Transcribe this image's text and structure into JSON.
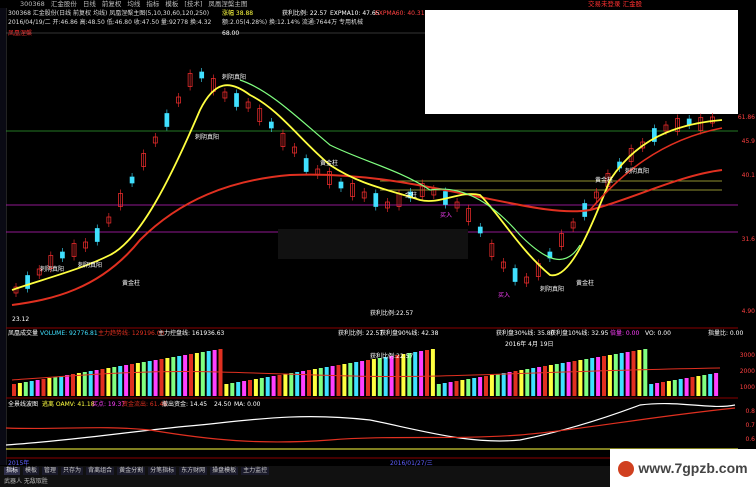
{
  "menu": [
    "300368",
    "汇金股份",
    "日线",
    "前复权",
    "均线",
    "指标",
    "模板",
    "[技术]",
    "凤凰涅槃主图"
  ],
  "right_tab": "交易未登录  汇金股",
  "header": {
    "line1": "300368 汇金股份(日线 前复权 均线) 凤凰涅槃主图(5,10,30,60,120,250)",
    "line1_b": "获利比例: 22.57",
    "line1_c": "EXPMA10: 47.65",
    "line1_d": "EXPMA60: 40.31",
    "line2": "2016/04/19/二 开:46.86 高:48.50 低:46.80 收:47.50 量:92778 换:4.32",
    "line2_b": "额:2.05(4.28%) 换:12.14% 流通:7644万 专用机械",
    "tag": "凤凰涅槃",
    "value_green": "涨幅 38.88"
  },
  "price_labels": {
    "top_value": "68.00",
    "low_value": "23.12",
    "volume_ratio_label": "获利比例:22.57"
  },
  "right_axis": [
    "61.86",
    "45.9",
    "40.1",
    "31.6",
    "4.90",
    "3000",
    "2000",
    "1000",
    "0.8",
    "0.7",
    "0.6"
  ],
  "annotations": [
    {
      "text": "刺阴真阳",
      "color": "#ffffff"
    },
    {
      "text": "刺阴真阳",
      "color": "#ffffff"
    },
    {
      "text": "刺阴真阳",
      "color": "#ffffff"
    },
    {
      "text": "刺阴真阳",
      "color": "#ffffff"
    },
    {
      "text": "黄金柱",
      "color": "#ffffff"
    },
    {
      "text": "黄金柱",
      "color": "#ffffff"
    },
    {
      "text": "黄金柱",
      "color": "#ffffff"
    },
    {
      "text": "买入",
      "color": "#ff40ff"
    },
    {
      "text": "买入",
      "color": "#ff40ff"
    },
    {
      "text": "刺阴真阳",
      "color": "#ffffff"
    },
    {
      "text": "金柱",
      "color": "#ffffff"
    },
    {
      "text": "刺阴真阳",
      "color": "#ffffff"
    },
    {
      "text": "黄金柱",
      "color": "#ffffff"
    }
  ],
  "volume_header": {
    "title": "凤凰成交量",
    "volume": "VOLUME: 92776.81",
    "main_line": "主力趋势线: 129196.00",
    "ctrl": "主力控盘线: 161936.63",
    "ratio": "获利比例: 22.57",
    "cost90": "获利盘90%线: 42.38",
    "cost30": "获利盘30%线: 35.80",
    "cost10": "获利盘10%线: 32.95",
    "vol_label": "倍量: 0.00",
    "vo": "VO: 0.00",
    "right": "指量比: 0.00"
  },
  "volume_date": "2016年 4月 19日",
  "osc_header": {
    "title": "全景线波图",
    "a": "逃离 OAMV: 41.18",
    "b": "买点: 19.37",
    "c": "资金流出: 61.48",
    "d": "撤出资金: 14.45",
    "e": "24.50",
    "f": "MA: 0.00"
  },
  "dates": {
    "left": "2015年",
    "mid": "2016/01/27/三"
  },
  "tabs": [
    "指标",
    "模板",
    "管理",
    "只存为",
    "背离组合",
    "黄金分割",
    "分笔指标",
    "东方财网",
    "操盘模板",
    "主力监控"
  ],
  "status": "武器人 无敌取胜",
  "watermark": "www.7gpzb.com",
  "colors": {
    "up": "#ff3030",
    "down": "#40e0ff",
    "ma_yellow": "#ffff40",
    "ma_red": "#e03020",
    "ma_green": "#80ff80"
  }
}
